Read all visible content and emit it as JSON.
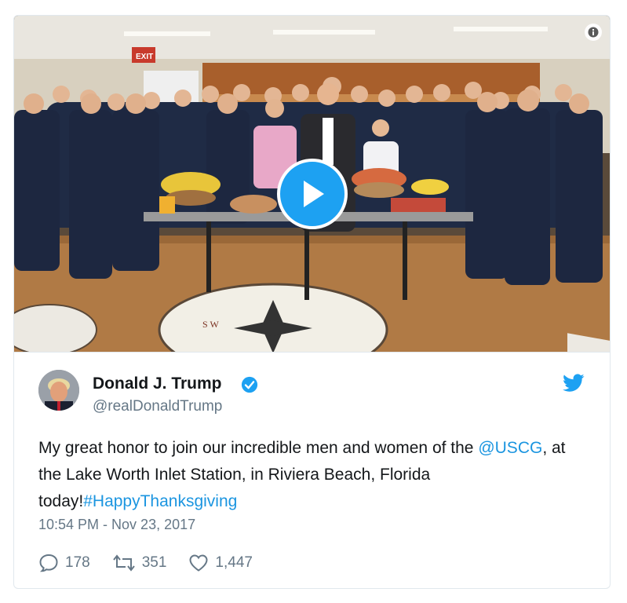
{
  "media": {
    "type": "video",
    "play_icon": "play-icon",
    "info_icon": "info-icon",
    "scene_sign": "EXIT",
    "scene_compass": "S W"
  },
  "author": {
    "name": "Donald J. Trump",
    "handle": "@realDonaldTrump",
    "verified": true,
    "verified_icon": "verified-badge-icon"
  },
  "platform_icon": "twitter-bird-icon",
  "tweet": {
    "text_part1": "My great honor to join our incredible men and women of the ",
    "mention": "@USCG",
    "text_part2": ", at the Lake Worth Inlet Station, in Riviera Beach, Florida today!",
    "hashtag": "#HappyThanksgiving",
    "timestamp": "10:54 PM - Nov 23, 2017"
  },
  "actions": {
    "replies": "178",
    "retweets": "351",
    "likes": "1,447"
  },
  "colors": {
    "accent": "#1da1f2",
    "link": "#1b95e0",
    "secondary_text": "#657786",
    "uniform": "#1f2b45",
    "floor": "#b07a45"
  }
}
